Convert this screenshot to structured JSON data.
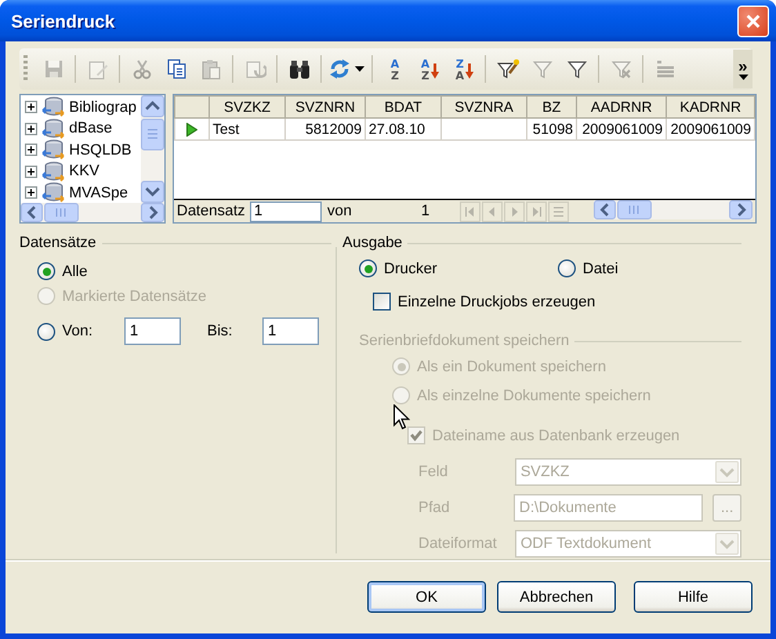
{
  "window": {
    "title": "Seriendruck"
  },
  "toolbar": {
    "items": [
      {
        "kind": "save",
        "disabled": true
      },
      {
        "kind": "separator"
      },
      {
        "kind": "edit",
        "disabled": true
      },
      {
        "kind": "separator"
      },
      {
        "kind": "cut",
        "disabled": true
      },
      {
        "kind": "copy",
        "disabled": false
      },
      {
        "kind": "paste",
        "disabled": true
      },
      {
        "kind": "separator"
      },
      {
        "kind": "insert",
        "disabled": true
      },
      {
        "kind": "separator"
      },
      {
        "kind": "find",
        "disabled": false
      },
      {
        "kind": "separator"
      },
      {
        "kind": "refresh",
        "disabled": false,
        "menu": true
      },
      {
        "kind": "separator"
      },
      {
        "kind": "sort",
        "disabled": false,
        "letters": [
          "A",
          "Z"
        ]
      },
      {
        "kind": "sort-ascending",
        "disabled": false,
        "letters": [
          "A",
          "Z"
        ]
      },
      {
        "kind": "sort-descending",
        "disabled": false,
        "letters": [
          "Z",
          "A"
        ]
      },
      {
        "kind": "separator"
      },
      {
        "kind": "autofilter",
        "disabled": false
      },
      {
        "kind": "filter",
        "disabled": true
      },
      {
        "kind": "filter",
        "disabled": false
      },
      {
        "kind": "separator"
      },
      {
        "kind": "remove-filter",
        "disabled": true
      },
      {
        "kind": "separator"
      },
      {
        "kind": "list",
        "disabled": true
      }
    ],
    "overflow": "»"
  },
  "data_sources": [
    {
      "label": "Bibliograp",
      "expanded": false
    },
    {
      "label": "dBase",
      "expanded": false
    },
    {
      "label": "HSQLDB",
      "expanded": false
    },
    {
      "label": "KKV",
      "expanded": false
    },
    {
      "label": "MVASpe",
      "expanded": false
    }
  ],
  "grid": {
    "columns": [
      "SVZKZ",
      "SVZNRN",
      "BDAT",
      "SVZNRA",
      "BZ",
      "AADRNR",
      "KADRNR"
    ],
    "rows": [
      {
        "current": true,
        "cells": [
          "Test",
          "5812009",
          "27.08.10",
          null,
          "51098",
          "2009061009",
          "2009061009"
        ]
      }
    ],
    "navigator": {
      "label": "Datensatz",
      "record": "1",
      "of_label": "von",
      "total": "1",
      "buttons": [
        {
          "kind": "first",
          "disabled": true
        },
        {
          "kind": "previous",
          "disabled": true
        },
        {
          "kind": "next",
          "disabled": true
        },
        {
          "kind": "last",
          "disabled": true
        },
        {
          "kind": "new",
          "disabled": true
        }
      ]
    }
  },
  "records": {
    "title": "Datensätze",
    "options": [
      {
        "label": "Alle",
        "selected": true,
        "disabled": false
      },
      {
        "label": "Markierte Datensätze",
        "selected": false,
        "disabled": true
      },
      {
        "label": "Von:",
        "selected": false,
        "disabled": false
      }
    ],
    "from": "1",
    "to_label": "Bis:",
    "to": "1"
  },
  "output": {
    "title": "Ausgabe",
    "targets": [
      {
        "label": "Drucker",
        "selected": true
      },
      {
        "label": "Datei",
        "selected": false
      }
    ],
    "separate_jobs": {
      "label": "Einzelne Druckjobs erzeugen",
      "checked": false
    },
    "save": {
      "title": "Serienbriefdokument speichern",
      "disabled": true,
      "options": [
        {
          "label": "Als ein Dokument speichern",
          "selected": true
        },
        {
          "label": "Als einzelne Dokumente speichern",
          "selected": false
        }
      ],
      "filename_from_db": {
        "label": "Dateiname aus Datenbank erzeugen",
        "checked": true
      },
      "fields": [
        {
          "kind": "select",
          "label": "Feld",
          "value": "SVZKZ"
        },
        {
          "kind": "path",
          "label": "Pfad",
          "value": "D:\\Dokumente",
          "browse": "..."
        },
        {
          "kind": "select",
          "label": "Dateiformat",
          "value": "ODF Textdokument"
        }
      ]
    }
  },
  "buttons": [
    {
      "label": "OK",
      "default": true
    },
    {
      "label": "Abbrechen",
      "default": false
    },
    {
      "label": "Hilfe",
      "default": false
    }
  ]
}
